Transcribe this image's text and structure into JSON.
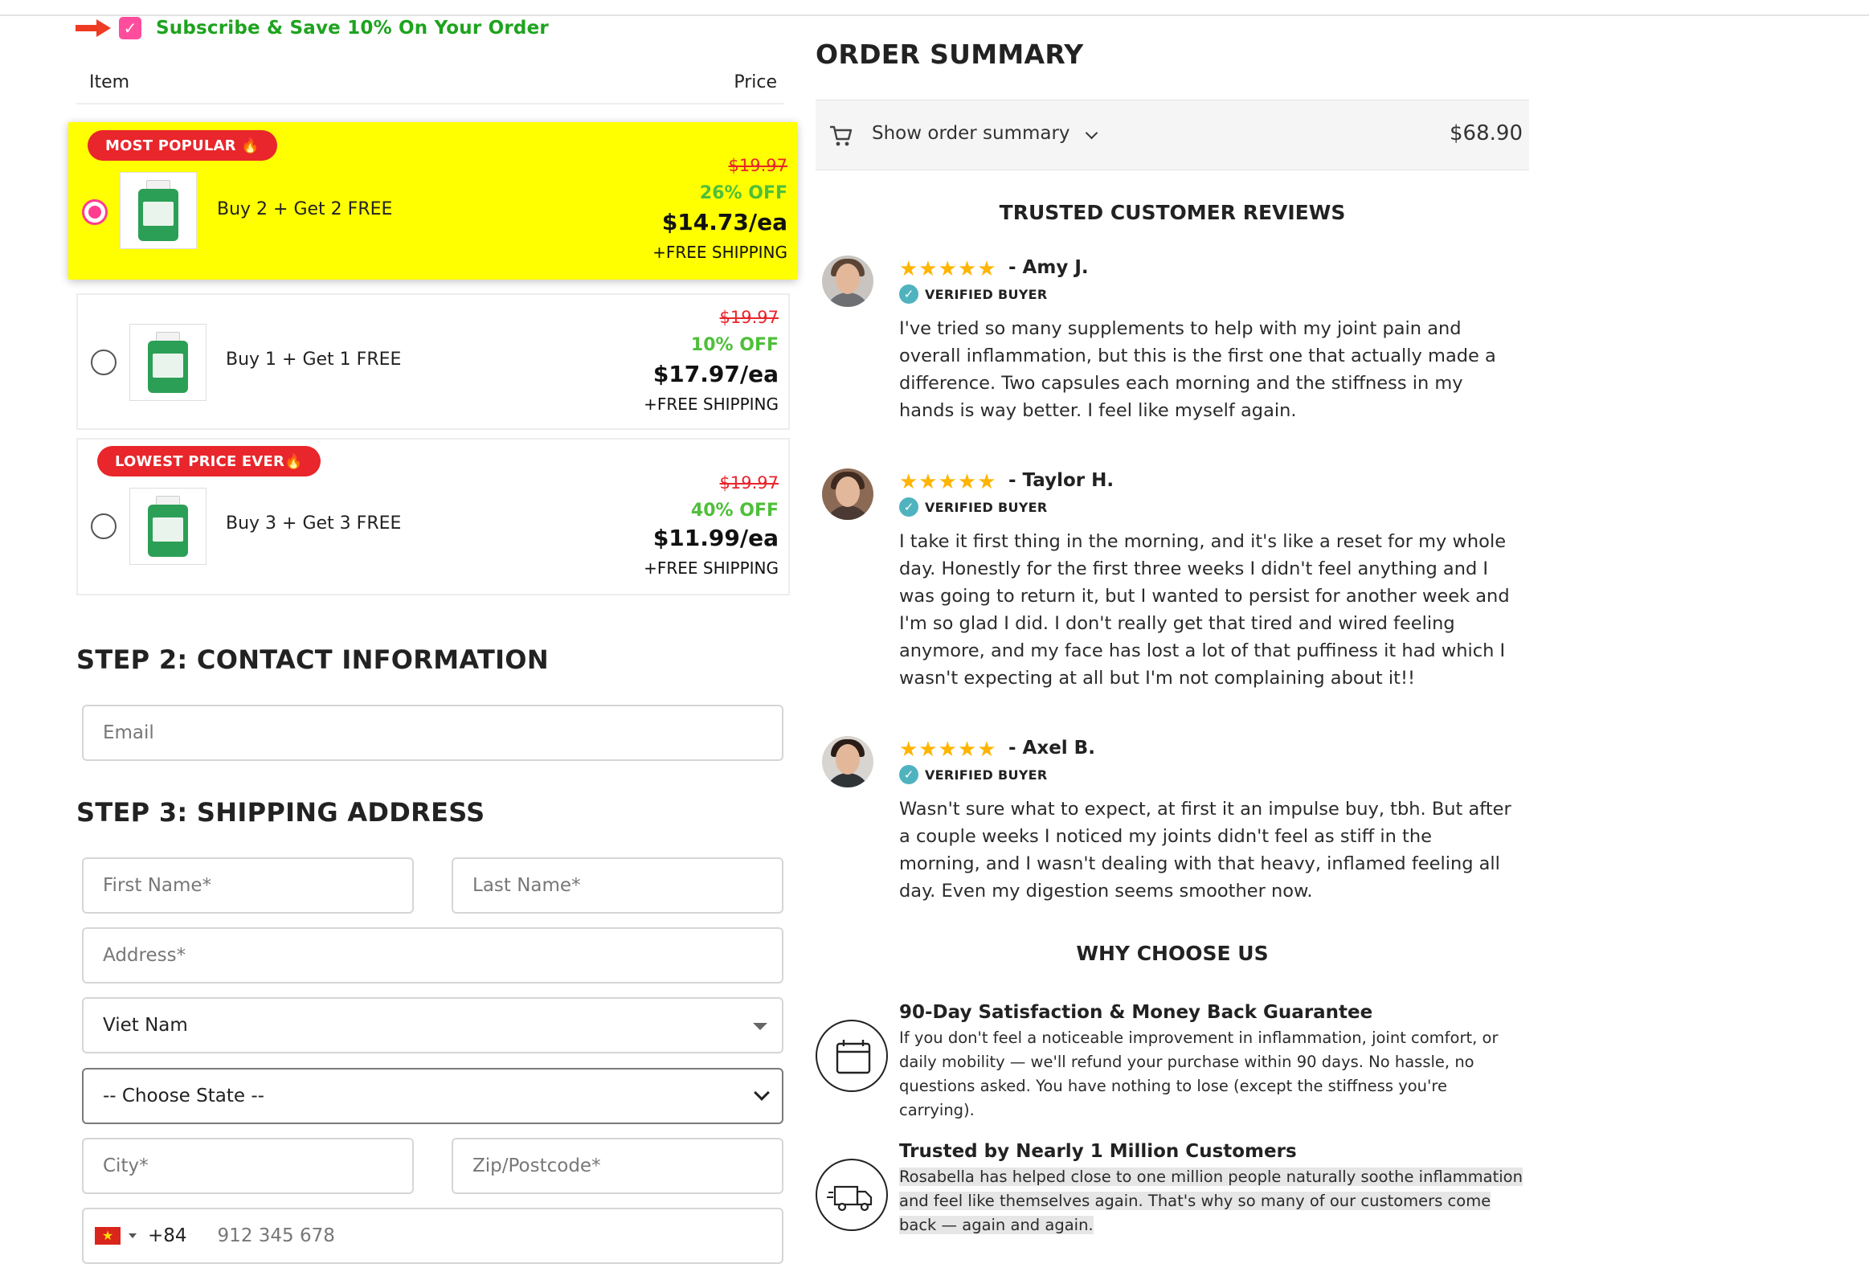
{
  "subscribe": {
    "label": "Subscribe & Save 10% On Your Order",
    "checked": true
  },
  "items_header": {
    "item": "Item",
    "price": "Price"
  },
  "offers": [
    {
      "badge": "MOST POPULAR 🔥",
      "name": "Buy 2 + Get 2 FREE",
      "old_price": "$19.97",
      "discount": "26% OFF",
      "unit_price": "$14.73/ea",
      "shipping": "+FREE SHIPPING",
      "selected": true
    },
    {
      "badge": "",
      "name": "Buy 1 + Get 1 FREE",
      "old_price": "$19.97",
      "discount": "10% OFF",
      "unit_price": "$17.97/ea",
      "shipping": "+FREE SHIPPING",
      "selected": false
    },
    {
      "badge": "LOWEST PRICE EVER🔥",
      "name": "Buy 3 + Get 3 FREE",
      "old_price": "$19.97",
      "discount": "40% OFF",
      "unit_price": "$11.99/ea",
      "shipping": "+FREE SHIPPING",
      "selected": false
    }
  ],
  "step2": {
    "title": "STEP 2: CONTACT INFORMATION",
    "email_placeholder": "Email"
  },
  "step3": {
    "title": "STEP 3: SHIPPING ADDRESS",
    "first_name_placeholder": "First Name*",
    "last_name_placeholder": "Last Name*",
    "address_placeholder": "Address*",
    "country_value": "Viet Nam",
    "state_value": "-- Choose State --",
    "city_placeholder": "City*",
    "zip_placeholder": "Zip/Postcode*",
    "phone_dial_code": "+84",
    "phone_placeholder": "912 345 678"
  },
  "order_summary": {
    "title": "ORDER SUMMARY",
    "toggle_label": "Show order summary",
    "total": "$68.90"
  },
  "reviews_title": "TRUSTED CUSTOMER REVIEWS",
  "reviews": [
    {
      "stars": "★★★★★",
      "name": "- Amy J.",
      "verified": "VERIFIED BUYER",
      "text": "I've tried so many supplements to help with my joint pain and overall inflammation, but this is the first one that actually made a difference. Two capsules each morning and the stiffness in my hands is way better. I feel like myself again."
    },
    {
      "stars": "★★★★★",
      "name": "- Taylor H.",
      "verified": "VERIFIED BUYER",
      "text": "I take it first thing in the morning, and it's like a reset for my whole day. Honestly for the first three weeks I didn't feel anything and I was going to return it, but I wanted to persist for another week and I'm so glad I did. I don't really get that tired and wired feeling anymore, and my face has lost a lot of that puffiness it had which I wasn't expecting at all but I'm not complaining about it!!"
    },
    {
      "stars": "★★★★★",
      "name": "- Axel B.",
      "verified": "VERIFIED BUYER",
      "text": "Wasn't sure what to expect, at first it an impulse buy, tbh. But after a couple weeks I noticed my joints didn't feel as stiff in the morning, and I wasn't dealing with that heavy, inflamed feeling all day. Even my digestion seems smoother now."
    }
  ],
  "why_title": "WHY CHOOSE US",
  "why_items": [
    {
      "icon": "calendar-icon",
      "title": "90-Day Satisfaction & Money Back Guarantee",
      "text": "If you don't feel a noticeable improvement in inflammation, joint comfort, or daily mobility — we'll refund your purchase within 90 days. No hassle, no questions asked. You have nothing to lose (except the stiffness you're carrying)."
    },
    {
      "icon": "delivery-truck-icon",
      "title": "Trusted by Nearly 1 Million Customers",
      "text": "Rosabella has helped close to one million people naturally soothe inflammation and feel like themselves again. That's why so many of our customers come back — again and again."
    }
  ],
  "colors": {
    "accent_green": "#1ea31e",
    "offer_highlight": "#ffff00",
    "badge_red": "#e8262b",
    "radio_pink": "#ff3c8e",
    "star_gold": "#ffb400"
  }
}
